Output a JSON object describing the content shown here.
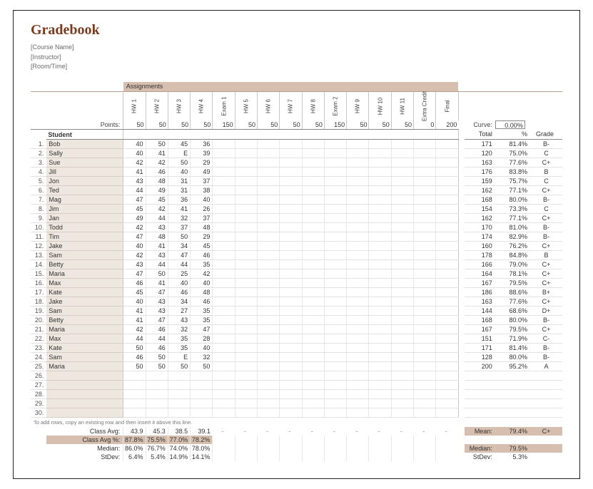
{
  "title": "Gradebook",
  "meta": {
    "course": "[Course Name]",
    "instructor": "[Instructor]",
    "room": "[Room/Time]"
  },
  "assignments_label": "Assignments",
  "points_label": "Points:",
  "student_head": "Student",
  "curve_label": "Curve:",
  "curve_value": "0.00%",
  "total_head": "Total",
  "pct_head": "%",
  "grade_head": "Grade",
  "assignments": [
    {
      "name": "HW 1",
      "points": "50"
    },
    {
      "name": "HW 2",
      "points": "50"
    },
    {
      "name": "HW 3",
      "points": "50"
    },
    {
      "name": "HW 4",
      "points": "50"
    },
    {
      "name": "Exam 1",
      "points": "150"
    },
    {
      "name": "HW 5",
      "points": "50"
    },
    {
      "name": "HW 6",
      "points": "50"
    },
    {
      "name": "HW 7",
      "points": "50"
    },
    {
      "name": "HW 8",
      "points": "50"
    },
    {
      "name": "Exam 2",
      "points": "150"
    },
    {
      "name": "HW 9",
      "points": "50"
    },
    {
      "name": "HW 10",
      "points": "50"
    },
    {
      "name": "HW 11",
      "points": "50"
    },
    {
      "name": "Extra Credit",
      "points": "0"
    },
    {
      "name": "Final",
      "points": "200"
    }
  ],
  "students": [
    {
      "n": "1.",
      "name": "Bob",
      "v": [
        "40",
        "50",
        "45",
        "36"
      ],
      "total": "171",
      "pct": "81.4%",
      "grade": "B-"
    },
    {
      "n": "2.",
      "name": "Sally",
      "v": [
        "40",
        "41",
        "E",
        "39"
      ],
      "total": "120",
      "pct": "75.0%",
      "grade": "C"
    },
    {
      "n": "3.",
      "name": "Sue",
      "v": [
        "42",
        "42",
        "50",
        "29"
      ],
      "total": "163",
      "pct": "77.6%",
      "grade": "C+"
    },
    {
      "n": "4.",
      "name": "Jill",
      "v": [
        "41",
        "46",
        "40",
        "49"
      ],
      "total": "176",
      "pct": "83.8%",
      "grade": "B"
    },
    {
      "n": "5.",
      "name": "Jon",
      "v": [
        "43",
        "48",
        "31",
        "37"
      ],
      "total": "159",
      "pct": "75.7%",
      "grade": "C"
    },
    {
      "n": "6.",
      "name": "Ted",
      "v": [
        "44",
        "49",
        "31",
        "38"
      ],
      "total": "162",
      "pct": "77.1%",
      "grade": "C+"
    },
    {
      "n": "7.",
      "name": "Mag",
      "v": [
        "47",
        "45",
        "36",
        "40"
      ],
      "total": "168",
      "pct": "80.0%",
      "grade": "B-"
    },
    {
      "n": "8.",
      "name": "Jim",
      "v": [
        "45",
        "42",
        "41",
        "26"
      ],
      "total": "154",
      "pct": "73.3%",
      "grade": "C"
    },
    {
      "n": "9.",
      "name": "Jan",
      "v": [
        "49",
        "44",
        "32",
        "37"
      ],
      "total": "162",
      "pct": "77.1%",
      "grade": "C+"
    },
    {
      "n": "10.",
      "name": "Todd",
      "v": [
        "42",
        "43",
        "37",
        "48"
      ],
      "total": "170",
      "pct": "81.0%",
      "grade": "B-"
    },
    {
      "n": "11.",
      "name": "Tim",
      "v": [
        "47",
        "48",
        "50",
        "29"
      ],
      "total": "174",
      "pct": "82.9%",
      "grade": "B-"
    },
    {
      "n": "12.",
      "name": "Jake",
      "v": [
        "40",
        "41",
        "34",
        "45"
      ],
      "total": "160",
      "pct": "76.2%",
      "grade": "C+"
    },
    {
      "n": "13.",
      "name": "Sam",
      "v": [
        "42",
        "43",
        "47",
        "46"
      ],
      "total": "178",
      "pct": "84.8%",
      "grade": "B"
    },
    {
      "n": "14.",
      "name": "Betty",
      "v": [
        "43",
        "44",
        "44",
        "35"
      ],
      "total": "166",
      "pct": "79.0%",
      "grade": "C+"
    },
    {
      "n": "15.",
      "name": "Maria",
      "v": [
        "47",
        "50",
        "25",
        "42"
      ],
      "total": "164",
      "pct": "78.1%",
      "grade": "C+"
    },
    {
      "n": "16.",
      "name": "Max",
      "v": [
        "46",
        "41",
        "40",
        "40"
      ],
      "total": "167",
      "pct": "79.5%",
      "grade": "C+"
    },
    {
      "n": "17.",
      "name": "Kate",
      "v": [
        "45",
        "47",
        "46",
        "48"
      ],
      "total": "186",
      "pct": "88.6%",
      "grade": "B+"
    },
    {
      "n": "18.",
      "name": "Jake",
      "v": [
        "40",
        "43",
        "34",
        "46"
      ],
      "total": "163",
      "pct": "77.6%",
      "grade": "C+"
    },
    {
      "n": "19.",
      "name": "Sam",
      "v": [
        "41",
        "43",
        "27",
        "35"
      ],
      "total": "144",
      "pct": "68.6%",
      "grade": "D+"
    },
    {
      "n": "20.",
      "name": "Betty",
      "v": [
        "41",
        "47",
        "43",
        "35"
      ],
      "total": "168",
      "pct": "80.0%",
      "grade": "B-"
    },
    {
      "n": "21.",
      "name": "Maria",
      "v": [
        "42",
        "46",
        "32",
        "47"
      ],
      "total": "167",
      "pct": "79.5%",
      "grade": "C+"
    },
    {
      "n": "22.",
      "name": "Max",
      "v": [
        "44",
        "44",
        "35",
        "28"
      ],
      "total": "151",
      "pct": "71.9%",
      "grade": "C-"
    },
    {
      "n": "23.",
      "name": "Kate",
      "v": [
        "50",
        "46",
        "35",
        "40"
      ],
      "total": "171",
      "pct": "81.4%",
      "grade": "B-"
    },
    {
      "n": "24.",
      "name": "Sam",
      "v": [
        "46",
        "50",
        "E",
        "32"
      ],
      "total": "128",
      "pct": "80.0%",
      "grade": "B-"
    },
    {
      "n": "25.",
      "name": "Maria",
      "v": [
        "50",
        "50",
        "50",
        "50"
      ],
      "total": "200",
      "pct": "95.2%",
      "grade": "A"
    }
  ],
  "empty_rows": [
    "26.",
    "27.",
    "28.",
    "29.",
    "30."
  ],
  "note": "To add rows, copy an existing row and then insert it above this line.",
  "summary": {
    "rows": [
      {
        "label": "Class Avg:",
        "vals": [
          "43.9",
          "45.3",
          "38.5",
          "39.1"
        ],
        "band": false
      },
      {
        "label": "Class Avg %:",
        "vals": [
          "87.8%",
          "75.5%",
          "77.0%",
          "78.2%"
        ],
        "band": true
      },
      {
        "label": "Median:",
        "vals": [
          "86.0%",
          "76.7%",
          "74.0%",
          "78.0%"
        ],
        "band": false
      },
      {
        "label": "StDev:",
        "vals": [
          "6.4%",
          "5.4%",
          "14.9%",
          "14.1%"
        ],
        "band": false
      }
    ],
    "dashes": "-",
    "right": [
      {
        "label": "Mean:",
        "val": "79.4%",
        "grade": "C+",
        "band": true
      },
      {
        "label": "",
        "val": "",
        "grade": "",
        "band": false
      },
      {
        "label": "Median:",
        "val": "79.5%",
        "grade": "",
        "band": true
      },
      {
        "label": "StDev:",
        "val": "5.3%",
        "grade": "",
        "band": false
      }
    ]
  }
}
